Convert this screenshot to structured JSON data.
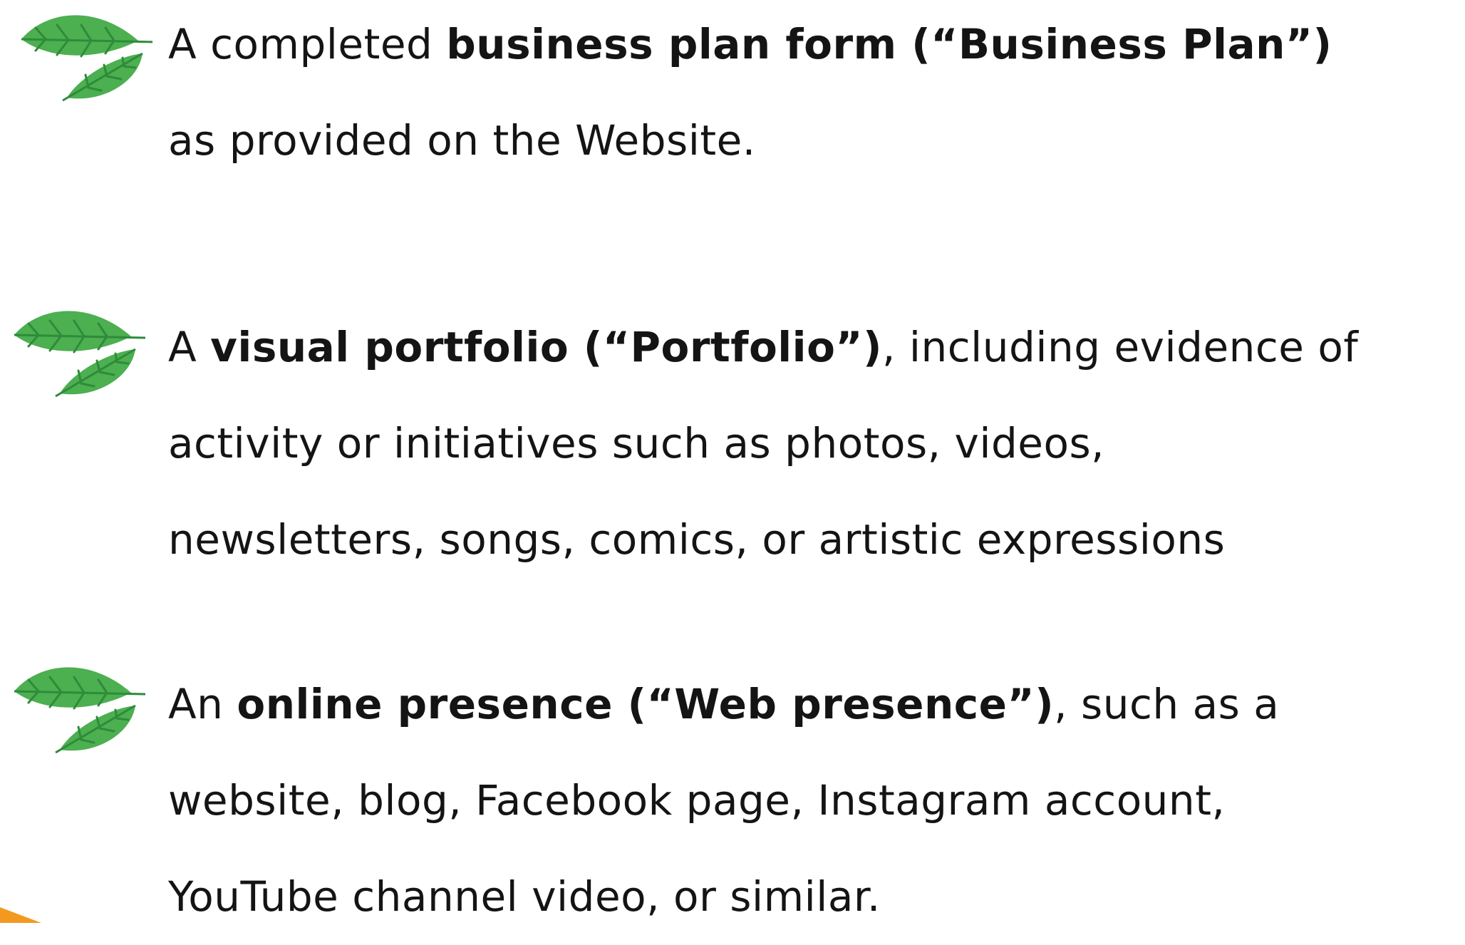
{
  "colors": {
    "text": "#141414",
    "leaf_green": "#4caf50",
    "leaf_vein": "#2e8b3a",
    "accent_orange": "#f29a1f"
  },
  "items": [
    {
      "icon": "leaf-icon",
      "lines": [
        {
          "pre": "A completed ",
          "bold": "business plan form (“Business Plan”)",
          "post": ""
        },
        {
          "pre": "as provided on the Website.",
          "bold": "",
          "post": ""
        }
      ]
    },
    {
      "icon": "leaf-icon",
      "lines": [
        {
          "pre": "A ",
          "bold": "visual portfolio (“Portfolio”)",
          "post": ", including evidence of"
        },
        {
          "pre": "activity or initiatives such as photos, videos,",
          "bold": "",
          "post": ""
        },
        {
          "pre": "newsletters, songs, comics, or artistic expressions",
          "bold": "",
          "post": ""
        }
      ]
    },
    {
      "icon": "leaf-icon",
      "lines": [
        {
          "pre": "An ",
          "bold": "online presence (“Web presence”)",
          "post": ", such as a"
        },
        {
          "pre": "website, blog, Facebook page, Instagram account,",
          "bold": "",
          "post": ""
        },
        {
          "pre": "YouTube channel video, or similar.",
          "bold": "",
          "post": ""
        }
      ]
    }
  ]
}
